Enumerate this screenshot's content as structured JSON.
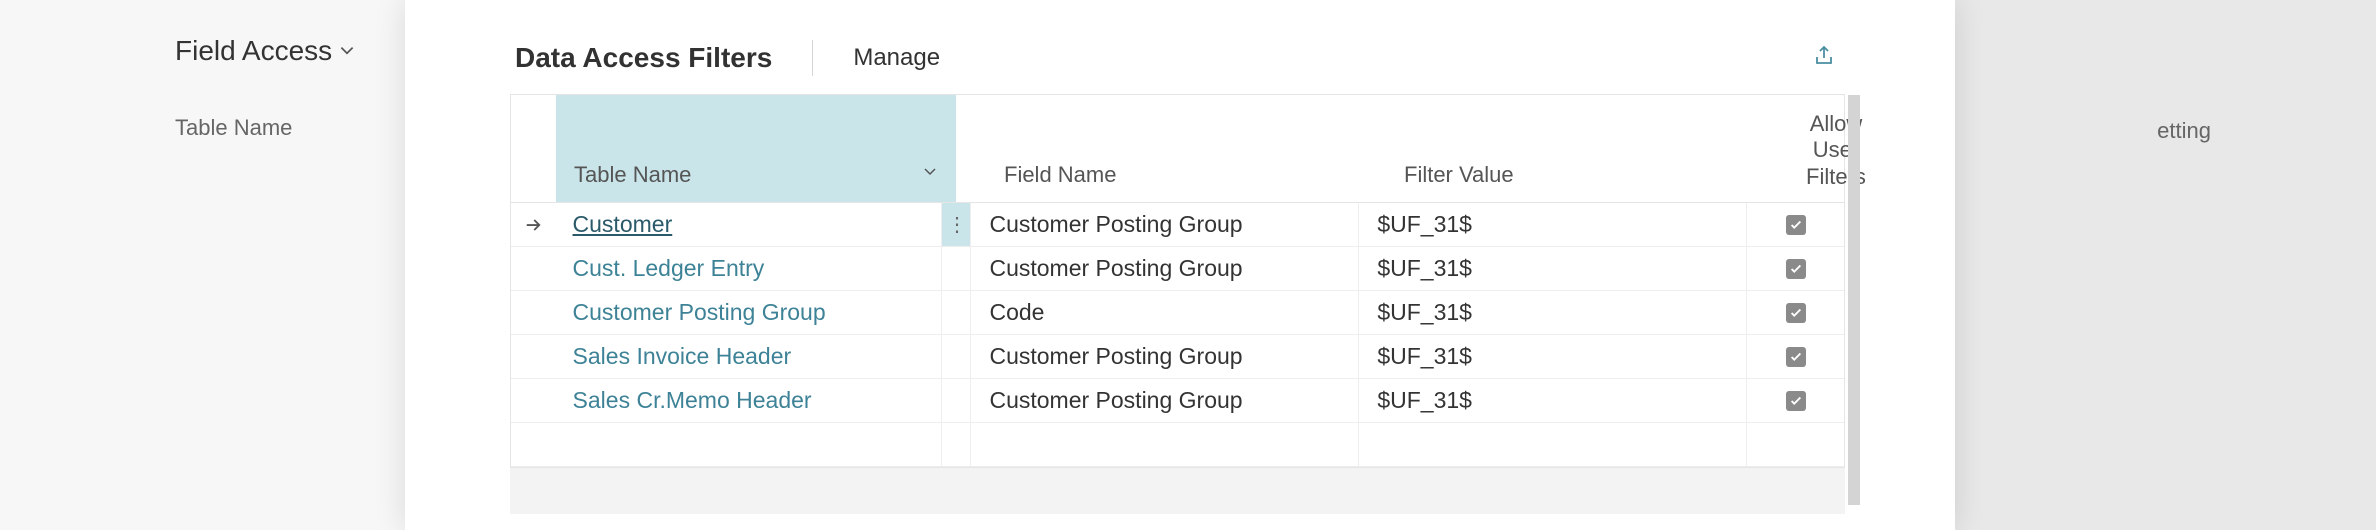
{
  "background": {
    "field_access_label": "Field Access",
    "table_name_label": "Table Name",
    "setting_label": "etting"
  },
  "panel": {
    "title": "Data Access Filters",
    "manage_label": "Manage"
  },
  "columns": {
    "table_name": "Table Name",
    "field_name": "Field Name",
    "filter_value": "Filter Value",
    "allow_line1": "Allow",
    "allow_line2": "User",
    "allow_line3": "Filters"
  },
  "rows": [
    {
      "table_name": "Customer",
      "field_name": "Customer Posting Group",
      "filter_value": "$UF_31$",
      "allow": true,
      "selected": true
    },
    {
      "table_name": "Cust. Ledger Entry",
      "field_name": "Customer Posting Group",
      "filter_value": "$UF_31$",
      "allow": true,
      "selected": false
    },
    {
      "table_name": "Customer Posting Group",
      "field_name": "Code",
      "filter_value": "$UF_31$",
      "allow": true,
      "selected": false
    },
    {
      "table_name": "Sales Invoice Header",
      "field_name": "Customer Posting Group",
      "filter_value": "$UF_31$",
      "allow": true,
      "selected": false
    },
    {
      "table_name": "Sales Cr.Memo Header",
      "field_name": "Customer Posting Group",
      "filter_value": "$UF_31$",
      "allow": true,
      "selected": false
    }
  ]
}
